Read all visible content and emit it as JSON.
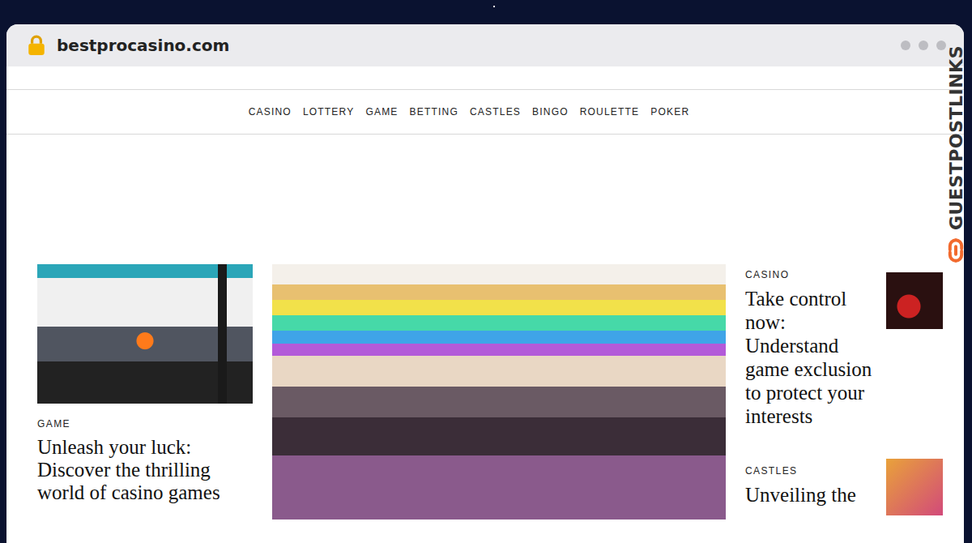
{
  "browser": {
    "url": "bestprocasino.com"
  },
  "nav": [
    "CASINO",
    "LOTTERY",
    "GAME",
    "BETTING",
    "CASTLES",
    "BINGO",
    "ROULETTE",
    "POKER"
  ],
  "featured": {
    "category": "GAME",
    "title": "Unleash your luck: Discover the thrilling world of casino games"
  },
  "sidebar": [
    {
      "category": "CASINO",
      "title": "Take control now: Understand game exclusion to protect your interests"
    },
    {
      "category": "CASTLES",
      "title": "Unveiling the"
    }
  ],
  "watermark": "GUESTPOSTLINKS"
}
